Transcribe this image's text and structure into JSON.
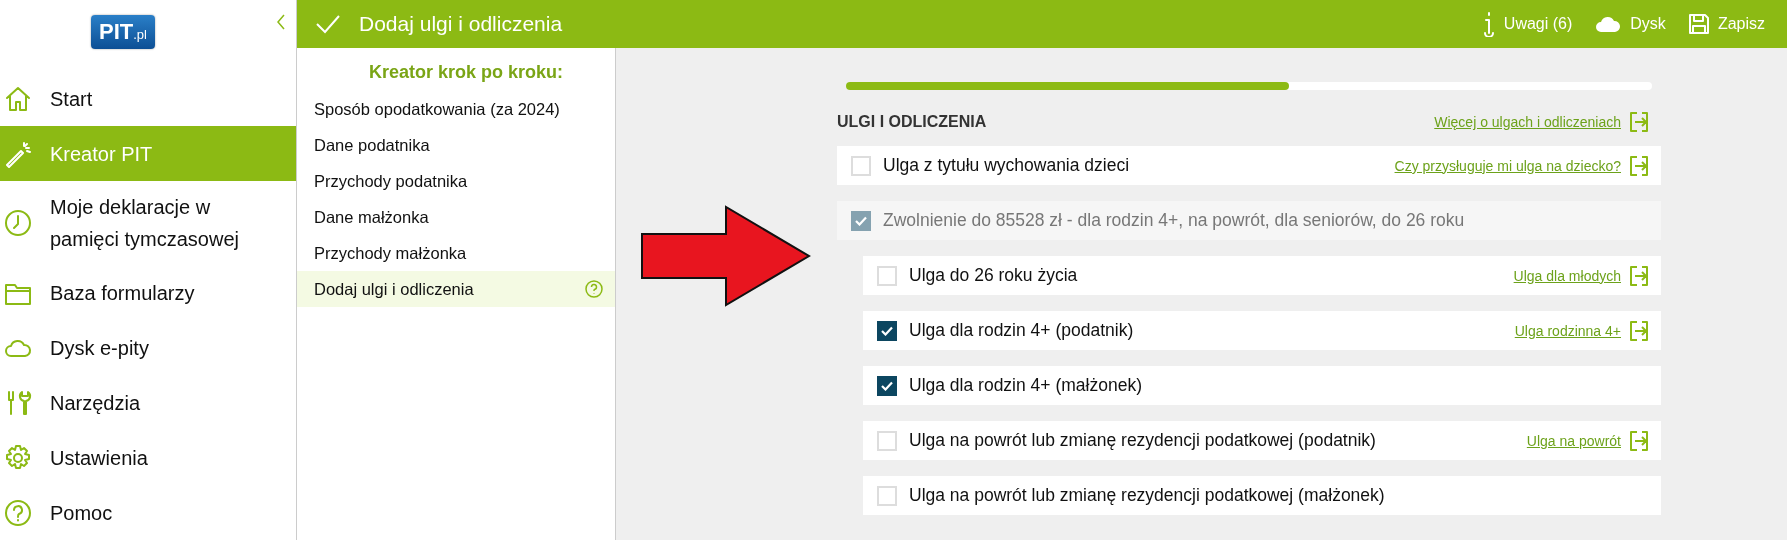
{
  "sidebar": {
    "logo": {
      "main": "PIT",
      "suffix": ".pl"
    },
    "items": [
      {
        "kind": "home",
        "label": "Start",
        "selected": false
      },
      {
        "kind": "wand",
        "label": "Kreator PIT",
        "selected": true
      },
      {
        "kind": "clock",
        "label": "Moje deklaracje w pamięci tymczasowej",
        "selected": false
      },
      {
        "kind": "folder",
        "label": "Baza formularzy",
        "selected": false
      },
      {
        "kind": "cloud",
        "label": "Dysk e-pity",
        "selected": false
      },
      {
        "kind": "tools",
        "label": "Narzędzia",
        "selected": false
      },
      {
        "kind": "gear",
        "label": "Ustawienia",
        "selected": false
      },
      {
        "kind": "help",
        "label": "Pomoc",
        "selected": false
      }
    ]
  },
  "topbar": {
    "title": "Dodaj ulgi i odliczenia",
    "actions": [
      {
        "kind": "info",
        "label": "Uwagi (6)"
      },
      {
        "kind": "cloud",
        "label": "Dysk"
      },
      {
        "kind": "save",
        "label": "Zapisz"
      }
    ]
  },
  "wizard": {
    "title": "Kreator krok po kroku:",
    "steps": [
      {
        "label": "Sposób opodatkowania (za 2024)",
        "selected": false
      },
      {
        "label": "Dane podatnika",
        "selected": false
      },
      {
        "label": "Przychody podatnika",
        "selected": false
      },
      {
        "label": "Dane małżonka",
        "selected": false
      },
      {
        "label": "Przychody małżonka",
        "selected": false
      },
      {
        "label": "Dodaj ulgi i odliczenia",
        "selected": true
      }
    ]
  },
  "progress": {
    "level": 0.55
  },
  "section": {
    "title": "ULGI I ODLICZENIA",
    "link": "Więcej o ulgach i odliczeniach"
  },
  "options": [
    {
      "label": "Ulga z tytułu wychowania dzieci",
      "checked": false,
      "disabled": false,
      "link": "Czy przysługuje mi ulga na dziecko?"
    },
    {
      "label": "Zwolnienie do 85528 zł - dla rodzin 4+, na powrót, dla seniorów, do 26 roku",
      "checked": true,
      "disabled": true,
      "children": [
        {
          "label": "Ulga do 26 roku życia",
          "checked": false,
          "disabled": false,
          "link": "Ulga dla młodych"
        },
        {
          "label": "Ulga dla rodzin 4+ (podatnik)",
          "checked": true,
          "disabled": false,
          "link": "Ulga rodzinna 4+"
        },
        {
          "label": "Ulga dla rodzin 4+ (małżonek)",
          "checked": true,
          "disabled": false
        },
        {
          "label": "Ulga na powrót lub zmianę rezydencji podatkowej (podatnik)",
          "checked": false,
          "disabled": false,
          "link": "Ulga na powrót"
        },
        {
          "label": "Ulga na powrót lub zmianę rezydencji podatkowej (małżonek)",
          "checked": false,
          "disabled": false
        }
      ]
    }
  ]
}
